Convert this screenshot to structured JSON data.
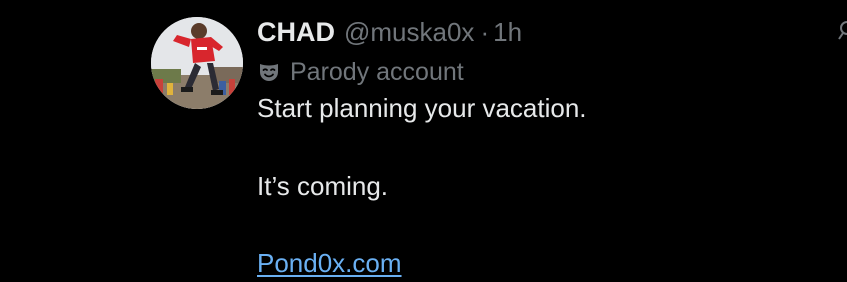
{
  "tweet": {
    "display_name": "CHAD",
    "handle": "@muska0x",
    "separator": "·",
    "time": "1h",
    "label": {
      "icon": "parody-mask-icon",
      "text": "Parody account"
    },
    "body": {
      "line1": "Start planning your vacation.",
      "line2": "It’s coming."
    },
    "link_text": "Pond0x.com"
  },
  "colors": {
    "background": "#000000",
    "primary_text": "#e7e9ea",
    "secondary_text": "#71767b",
    "link": "#6ab0f3"
  }
}
